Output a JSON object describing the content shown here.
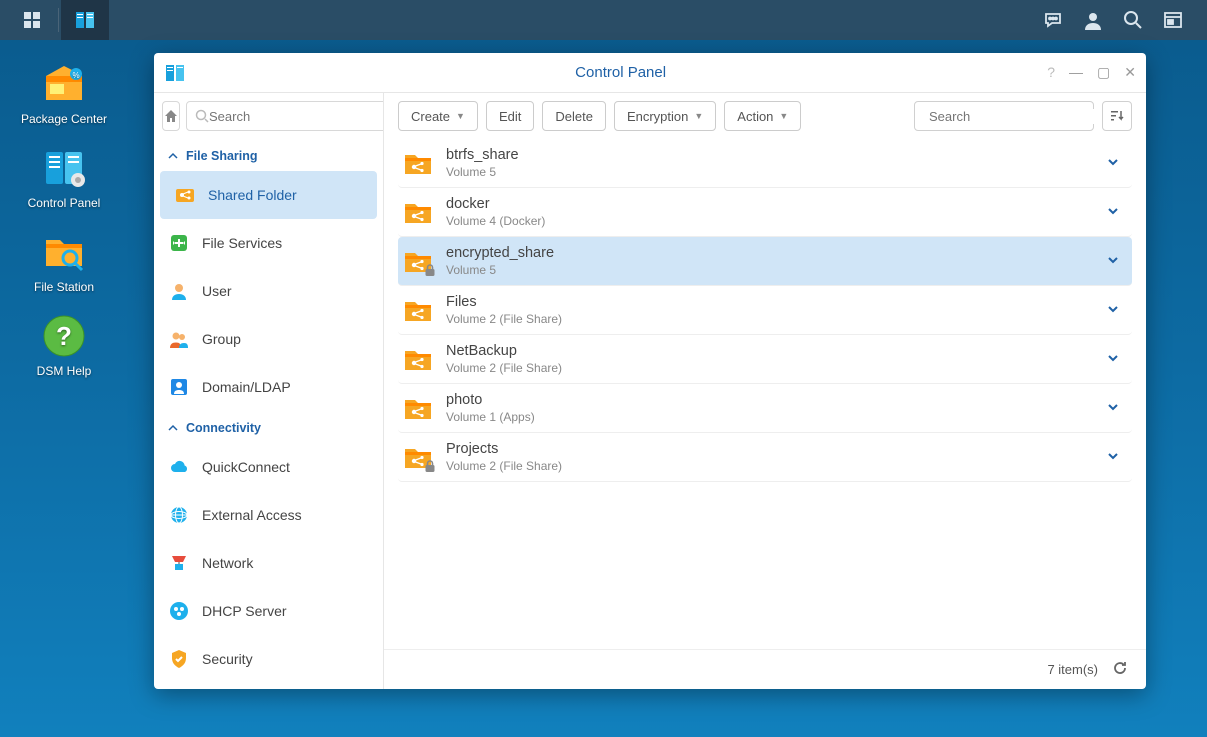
{
  "topbar": {
    "apps_icon": "apps",
    "running_app": "control-panel"
  },
  "desktop": {
    "items": [
      {
        "label": "Package Center",
        "icon": "package"
      },
      {
        "label": "Control Panel",
        "icon": "control-panel"
      },
      {
        "label": "File Station",
        "icon": "file-station"
      },
      {
        "label": "DSM Help",
        "icon": "help"
      }
    ]
  },
  "window": {
    "title": "Control Panel",
    "sidebar": {
      "search_placeholder": "Search",
      "sections": [
        {
          "label": "File Sharing",
          "items": [
            {
              "label": "Shared Folder",
              "icon": "shared-folder",
              "selected": true
            },
            {
              "label": "File Services",
              "icon": "file-services"
            },
            {
              "label": "User",
              "icon": "user"
            },
            {
              "label": "Group",
              "icon": "group"
            },
            {
              "label": "Domain/LDAP",
              "icon": "domain"
            }
          ]
        },
        {
          "label": "Connectivity",
          "items": [
            {
              "label": "QuickConnect",
              "icon": "quickconnect"
            },
            {
              "label": "External Access",
              "icon": "external"
            },
            {
              "label": "Network",
              "icon": "network"
            },
            {
              "label": "DHCP Server",
              "icon": "dhcp"
            },
            {
              "label": "Security",
              "icon": "security"
            }
          ]
        }
      ]
    },
    "toolbar": {
      "create": "Create",
      "edit": "Edit",
      "delete": "Delete",
      "encryption": "Encryption",
      "action": "Action",
      "search_placeholder": "Search"
    },
    "shares": [
      {
        "name": "btrfs_share",
        "location": "Volume 5",
        "locked": false
      },
      {
        "name": "docker",
        "location": "Volume 4 (Docker)",
        "locked": false
      },
      {
        "name": "encrypted_share",
        "location": "Volume 5",
        "locked": true,
        "selected": true
      },
      {
        "name": "Files",
        "location": "Volume 2 (File Share)",
        "locked": false
      },
      {
        "name": "NetBackup",
        "location": "Volume 2 (File Share)",
        "locked": false
      },
      {
        "name": "photo",
        "location": "Volume 1 (Apps)",
        "locked": false
      },
      {
        "name": "Projects",
        "location": "Volume 2 (File Share)",
        "locked": true
      }
    ],
    "footer": {
      "count_text": "7 item(s)"
    }
  }
}
